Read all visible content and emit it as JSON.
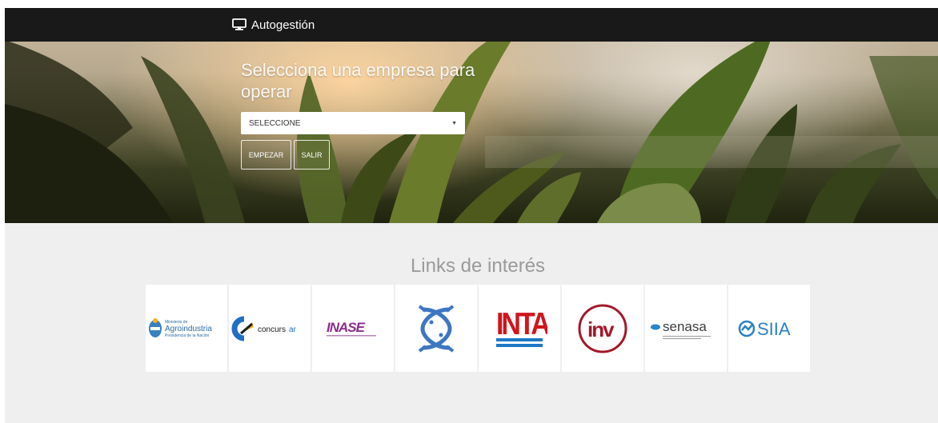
{
  "navbar": {
    "brand_label": "Autogestión",
    "brand_icon": "monitor-icon"
  },
  "hero": {
    "title": "Selecciona una empresa para operar",
    "select": {
      "value": "SELECCIONE"
    },
    "start_button": "EMPEZAR",
    "exit_button": "SALIR"
  },
  "links": {
    "title": "Links de interés",
    "items": [
      {
        "name": "agroindustria",
        "lines": [
          "Ministerio de",
          "Agroindustria",
          "Presidencia de la Nación"
        ]
      },
      {
        "name": "concursar",
        "text_a": "concurs",
        "text_b": "ar"
      },
      {
        "name": "inase",
        "text": "INASE"
      },
      {
        "name": "fish-logo"
      },
      {
        "name": "inta",
        "text": "INTA"
      },
      {
        "name": "inv",
        "text": "inv"
      },
      {
        "name": "senasa",
        "text": "senasa"
      },
      {
        "name": "siia",
        "text": "SIIA"
      }
    ]
  },
  "colors": {
    "navbar": "#191919",
    "section_bg": "#efefef",
    "inta_red": "#d0161c",
    "inta_blue": "#1c78c4",
    "inv_red": "#a3182a",
    "senasa_blue": "#2b86c9",
    "siia_blue": "#2b7fc4",
    "concursar_blue": "#1f6fc5",
    "inase_purple": "#8a2d8e"
  }
}
